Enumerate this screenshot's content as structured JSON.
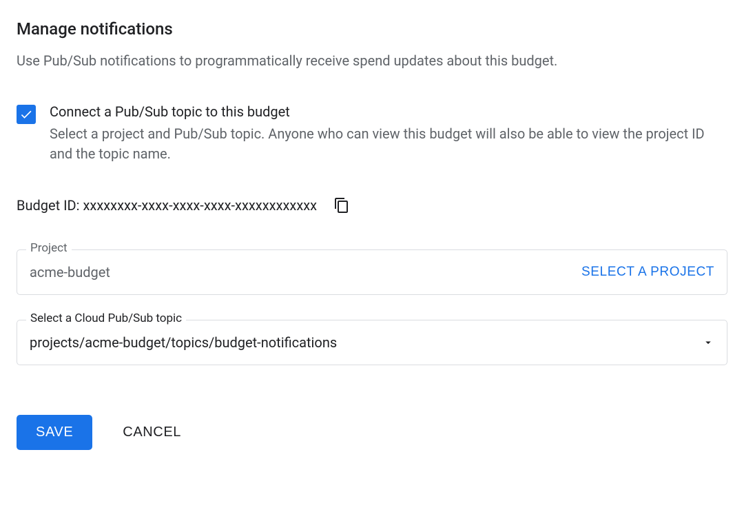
{
  "section": {
    "title": "Manage notifications",
    "description": "Use Pub/Sub notifications to programmatically receive spend updates about this budget."
  },
  "checkbox": {
    "label": "Connect a Pub/Sub topic to this budget",
    "description": "Select a project and Pub/Sub topic. Anyone who can view this budget will also be able to view the project ID and the topic name."
  },
  "budgetId": {
    "label": "Budget ID: ",
    "value": "xxxxxxxx-xxxx-xxxx-xxxx-xxxxxxxxxxxx"
  },
  "project": {
    "label": "Project",
    "value": "acme-budget",
    "selectButton": "SELECT A PROJECT"
  },
  "topic": {
    "label": "Select a Cloud Pub/Sub topic",
    "value": "projects/acme-budget/topics/budget-notifications"
  },
  "actions": {
    "save": "SAVE",
    "cancel": "CANCEL"
  }
}
